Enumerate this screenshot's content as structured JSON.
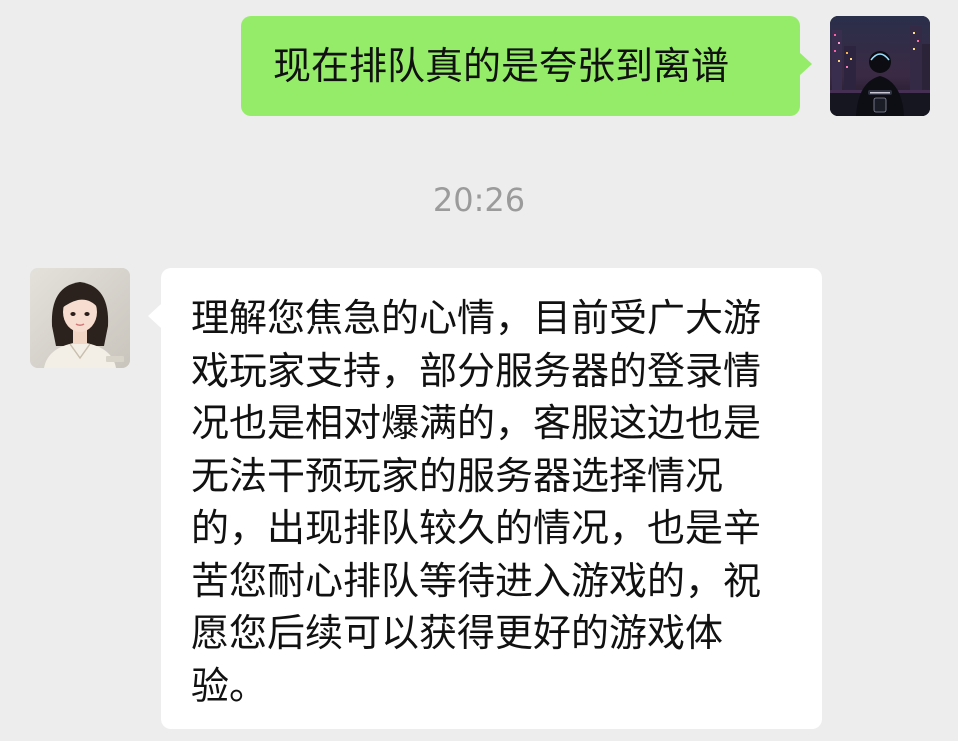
{
  "chat": {
    "outgoing": {
      "text": "现在排队真的是夸张到离谱",
      "bubble_color": "#95ec69",
      "avatar": "user-avatar-night-city"
    },
    "timestamp": "20:26",
    "incoming": {
      "text": "理解您焦急的心情，目前受广大游戏玩家支持，部分服务器的登录情况也是相对爆满的，客服这边也是无法干预玩家的服务器选择情况的，出现排队较久的情况，也是辛苦您耐心排队等待进入游戏的，祝愿您后续可以获得更好的游戏体验。",
      "bubble_color": "#ffffff",
      "avatar": "agent-avatar-woman"
    },
    "background_color": "#ededed"
  }
}
